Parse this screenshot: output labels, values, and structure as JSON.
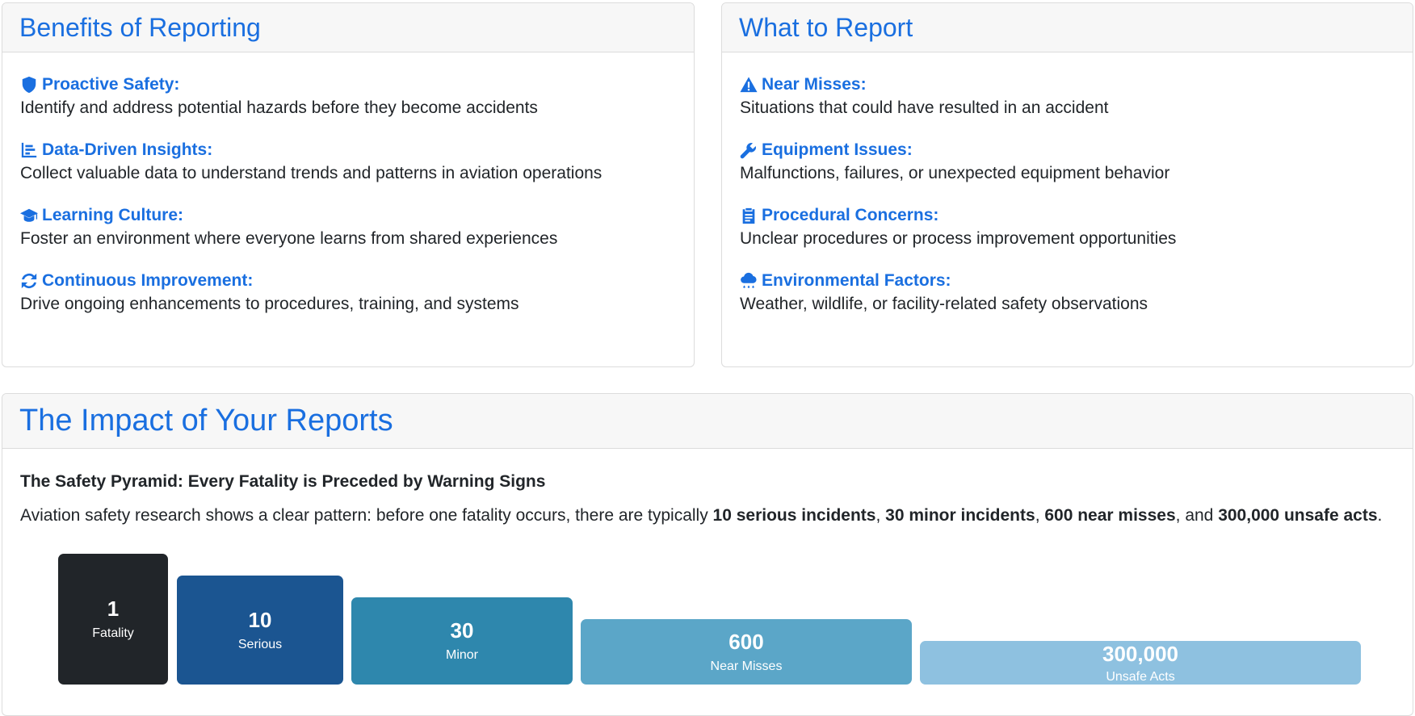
{
  "benefits": {
    "title": "Benefits of Reporting",
    "items": [
      {
        "icon": "shield-icon",
        "title": "Proactive Safety:",
        "desc": "Identify and address potential hazards before they become accidents"
      },
      {
        "icon": "chart-bar-icon",
        "title": "Data-Driven Insights:",
        "desc": "Collect valuable data to understand trends and patterns in aviation operations"
      },
      {
        "icon": "graduation-cap-icon",
        "title": "Learning Culture:",
        "desc": "Foster an environment where everyone learns from shared experiences"
      },
      {
        "icon": "refresh-icon",
        "title": "Continuous Improvement:",
        "desc": "Drive ongoing enhancements to procedures, training, and systems"
      }
    ]
  },
  "what_to_report": {
    "title": "What to Report",
    "items": [
      {
        "icon": "warning-icon",
        "title": "Near Misses:",
        "desc": "Situations that could have resulted in an accident"
      },
      {
        "icon": "wrench-icon",
        "title": "Equipment Issues:",
        "desc": "Malfunctions, failures, or unexpected equipment behavior"
      },
      {
        "icon": "clipboard-icon",
        "title": "Procedural Concerns:",
        "desc": "Unclear procedures or process improvement opportunities"
      },
      {
        "icon": "cloud-rain-icon",
        "title": "Environmental Factors:",
        "desc": "Weather, wildlife, or facility-related safety observations"
      }
    ]
  },
  "impact": {
    "title": "The Impact of Your Reports",
    "heading": "The Safety Pyramid: Every Fatality is Preceded by Warning Signs",
    "text_parts": [
      "Aviation safety research shows a clear pattern: before one fatality occurs, there are typically ",
      "10 serious incidents",
      ", ",
      "30 minor incidents",
      ", ",
      "600 near misses",
      ", and ",
      "300,000 unsafe acts",
      "."
    ],
    "pyramid": [
      {
        "value": "1",
        "label": "Fatality",
        "color": "#212529"
      },
      {
        "value": "10",
        "label": "Serious",
        "color": "#1b5591"
      },
      {
        "value": "30",
        "label": "Minor",
        "color": "#2e87ad"
      },
      {
        "value": "600",
        "label": "Near Misses",
        "color": "#5ba6c8"
      },
      {
        "value": "300,000",
        "label": "Unsafe Acts",
        "color": "#8ec1e0"
      }
    ]
  },
  "colors": {
    "accent": "#1a6fe0",
    "text": "#212529"
  }
}
